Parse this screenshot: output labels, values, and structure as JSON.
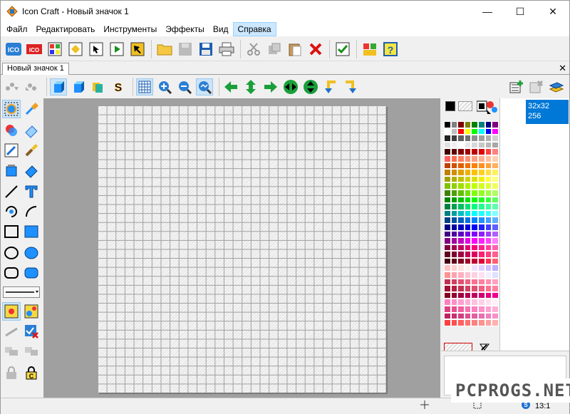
{
  "window": {
    "title": "Icon Craft - Новый значок 1",
    "controls": {
      "minimize": "—",
      "maximize": "☐",
      "close": "✕"
    }
  },
  "menu": [
    {
      "label": "Файл"
    },
    {
      "label": "Редактировать"
    },
    {
      "label": "Инструменты"
    },
    {
      "label": "Эффекты"
    },
    {
      "label": "Вид"
    },
    {
      "label": "Справка",
      "active": true
    }
  ],
  "document": {
    "tab_label": "Новый значок 1",
    "close_glyph": "✕"
  },
  "formats": {
    "selected": {
      "size": "32x32",
      "colors": "256"
    }
  },
  "status": {
    "zoom": "13:1"
  },
  "watermark": "PCPROGS.NET",
  "colors": {
    "accent": "#0078d7",
    "canvas_bg": "#a0a0a0",
    "menu_active": "#cce8ff"
  },
  "palette_rows": [
    [
      "#000000",
      "#808080",
      "#800000",
      "#808000",
      "#008000",
      "#008080",
      "#000080",
      "#800080"
    ],
    [
      "#ffffff",
      "#c0c0c0",
      "#ff0000",
      "#ffff00",
      "#00ff00",
      "#00ffff",
      "#0000ff",
      "#ff00ff"
    ],
    [
      "#202020",
      "#404040",
      "#606060",
      "#707070",
      "#909090",
      "#a0a0a0",
      "#b0b0b0",
      "#d0d0d0"
    ],
    [
      "#e0e0e0",
      "#f0f0f0",
      "#ffffff",
      "#e8e8e8",
      "#d8d8d8",
      "#c8c8c8",
      "#b8b8b8",
      "#a8a8a8"
    ],
    [
      "#400000",
      "#600000",
      "#800000",
      "#a00000",
      "#c00000",
      "#e00000",
      "#ff4040",
      "#ff8080"
    ],
    [
      "#ff6060",
      "#ff7050",
      "#ff8060",
      "#ff9070",
      "#ffa080",
      "#ffb090",
      "#ffc0a0",
      "#ffd0b0"
    ],
    [
      "#c04000",
      "#d05000",
      "#e06000",
      "#f07000",
      "#ff8000",
      "#ff9020",
      "#ffa040",
      "#ffb060"
    ],
    [
      "#c08000",
      "#d09000",
      "#e0a000",
      "#f0b000",
      "#ffc000",
      "#ffd020",
      "#ffe040",
      "#fff060"
    ],
    [
      "#a0a000",
      "#b0b000",
      "#c0c000",
      "#d0d000",
      "#e0e000",
      "#f0f000",
      "#ffff40",
      "#ffff80"
    ],
    [
      "#80c000",
      "#90d000",
      "#a0e000",
      "#b0f000",
      "#c0ff00",
      "#d0ff20",
      "#e0ff40",
      "#f0ff60"
    ],
    [
      "#408000",
      "#50a000",
      "#60c000",
      "#70e000",
      "#80ff00",
      "#90ff20",
      "#a0ff40",
      "#b0ff60"
    ],
    [
      "#008000",
      "#00a000",
      "#00c000",
      "#00e000",
      "#00ff00",
      "#20ff20",
      "#40ff40",
      "#60ff60"
    ],
    [
      "#008040",
      "#00a050",
      "#00c060",
      "#00e070",
      "#00ff80",
      "#20ff90",
      "#40ffa0",
      "#60ffb0"
    ],
    [
      "#008080",
      "#00a0a0",
      "#00c0c0",
      "#00e0e0",
      "#00ffff",
      "#20ffff",
      "#40ffff",
      "#80ffff"
    ],
    [
      "#004080",
      "#0050a0",
      "#0060c0",
      "#0070e0",
      "#0080ff",
      "#2090ff",
      "#40a0ff",
      "#60b0ff"
    ],
    [
      "#000080",
      "#0000a0",
      "#0000c0",
      "#0000e0",
      "#0000ff",
      "#2020ff",
      "#4040ff",
      "#6060ff"
    ],
    [
      "#400080",
      "#5000a0",
      "#6000c0",
      "#7000e0",
      "#8000ff",
      "#9020ff",
      "#a040ff",
      "#b060ff"
    ],
    [
      "#800080",
      "#a000a0",
      "#c000c0",
      "#e000e0",
      "#ff00ff",
      "#ff20ff",
      "#ff40ff",
      "#ff80ff"
    ],
    [
      "#800040",
      "#a00050",
      "#c00060",
      "#e00070",
      "#ff0080",
      "#ff2090",
      "#ff40a0",
      "#ff60b0"
    ],
    [
      "#600020",
      "#800030",
      "#a00040",
      "#c00050",
      "#e00060",
      "#ff2070",
      "#ff4080",
      "#ff6090"
    ],
    [
      "#400010",
      "#600018",
      "#800020",
      "#a00028",
      "#c00030",
      "#e00038",
      "#ff3050",
      "#ff6070"
    ],
    [
      "#ffc0c0",
      "#ffd0d0",
      "#ffe0e0",
      "#fff0f0",
      "#f0e0ff",
      "#e0d0ff",
      "#d0c0ff",
      "#c0b0ff"
    ],
    [
      "#ff9090",
      "#ffa0b0",
      "#ffb0c0",
      "#ffc0d0",
      "#ffd0e0",
      "#ffe0f0",
      "#f0f0ff",
      "#e0e0ff"
    ],
    [
      "#c03050",
      "#d04060",
      "#e05070",
      "#f06080",
      "#ff7090",
      "#ff80a0",
      "#ff90b0",
      "#ffa0c0"
    ],
    [
      "#a01030",
      "#b02040",
      "#c03050",
      "#d04060",
      "#e05070",
      "#f06080",
      "#ff7090",
      "#ff80a0"
    ],
    [
      "#800020",
      "#900030",
      "#a00040",
      "#b00050",
      "#c00060",
      "#d00070",
      "#e00080",
      "#f00090"
    ],
    [
      "#ff80c0",
      "#ff90c8",
      "#ffa0d0",
      "#ffb0d8",
      "#ffc0e0",
      "#ffd0e8",
      "#ffe0f0",
      "#fff0f8"
    ],
    [
      "#e04080",
      "#e85090",
      "#f060a0",
      "#f870b0",
      "#ff80c0",
      "#ff90c8",
      "#ffa0d0",
      "#ffb0d8"
    ],
    [
      "#c02060",
      "#c83070",
      "#d04080",
      "#d85090",
      "#e060a0",
      "#e870b0",
      "#f080c0",
      "#f890c8"
    ],
    [
      "#ff4040",
      "#ff5050",
      "#ff6060",
      "#ff7070",
      "#ff8080",
      "#ff9090",
      "#ffa0a0",
      "#ffb0b0"
    ]
  ]
}
